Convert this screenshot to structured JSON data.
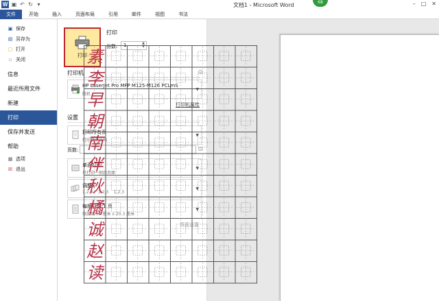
{
  "app": {
    "title": "文档1 - Microsoft Word",
    "badge": "68",
    "logo_letter": "W"
  },
  "ribbon_tabs": [
    "文件",
    "开始",
    "插入",
    "页面布局",
    "引用",
    "邮件",
    "视图",
    "书法"
  ],
  "sidebar": {
    "quick_items": [
      {
        "label": "保存",
        "icon": "save-icon"
      },
      {
        "label": "另存为",
        "icon": "save-as-icon"
      },
      {
        "label": "打开",
        "icon": "open-folder-icon"
      },
      {
        "label": "关闭",
        "icon": "close-doc-icon"
      }
    ],
    "categories": [
      "信息",
      "最近所用文件",
      "新建",
      "打印",
      "保存并发送",
      "帮助"
    ],
    "active": "打印",
    "bottom_items": [
      {
        "label": "选项",
        "icon": "options-icon"
      },
      {
        "label": "退出",
        "icon": "exit-icon"
      }
    ]
  },
  "print": {
    "heading": "打印",
    "button_label": "打印",
    "copies_label": "份数:",
    "copies_value": "1"
  },
  "printer": {
    "section_title": "打印机",
    "name": "HP LaserJet Pro MFP M125-M126 PCLmS",
    "status": "脱机",
    "properties_link": "打印机属性"
  },
  "settings": {
    "section_title": "设置",
    "range": {
      "l1": "打印所有页",
      "l2": "打印整个文档"
    },
    "pages_label": "页数:",
    "sides": {
      "l1": "单面打印",
      "l2": "只打印一侧的页面"
    },
    "collate": {
      "l1": "调整",
      "l2": "1,2,3    1,2,3    1,2,3"
    },
    "per_sheet": {
      "l1": "每版打印 1 页",
      "l2": "缩放到 14 厘米 x 20.3 厘米"
    },
    "page_setup_link": "页面设置"
  },
  "preview": {
    "grid_chars": [
      "素",
      "李",
      "早",
      "朝",
      "南",
      "伴",
      "秋",
      "橘",
      "诚",
      "赵",
      "读"
    ],
    "char_color": "#b8344a",
    "grid_line_color": "#555555"
  },
  "colors": {
    "accent": "#2b579a",
    "highlight": "#fde99f",
    "highlight_border": "#c1272d"
  }
}
